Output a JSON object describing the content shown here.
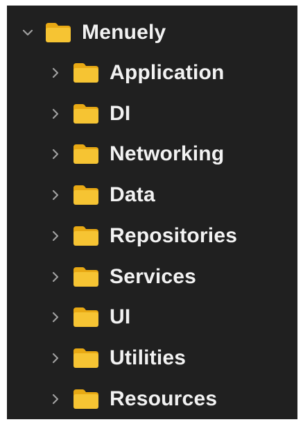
{
  "navigator": {
    "root": {
      "label": "Menuely",
      "expanded": true,
      "icon": "folder-icon",
      "disclosure_icon": "chevron-down-icon"
    },
    "children": [
      {
        "label": "Application",
        "expanded": false
      },
      {
        "label": "DI",
        "expanded": false
      },
      {
        "label": "Networking",
        "expanded": false
      },
      {
        "label": "Data",
        "expanded": false
      },
      {
        "label": "Repositories",
        "expanded": false
      },
      {
        "label": "Services",
        "expanded": false
      },
      {
        "label": "UI",
        "expanded": false
      },
      {
        "label": "Utilities",
        "expanded": false
      },
      {
        "label": "Resources",
        "expanded": false
      }
    ],
    "child_icon": "folder-icon",
    "child_disclosure_icon": "chevron-right-icon"
  },
  "colors": {
    "background": "#202020",
    "text": "#f2f2f2",
    "chevron": "#a0a0a0",
    "folder_body": "#f6c433",
    "folder_tab": "#e8a914"
  }
}
